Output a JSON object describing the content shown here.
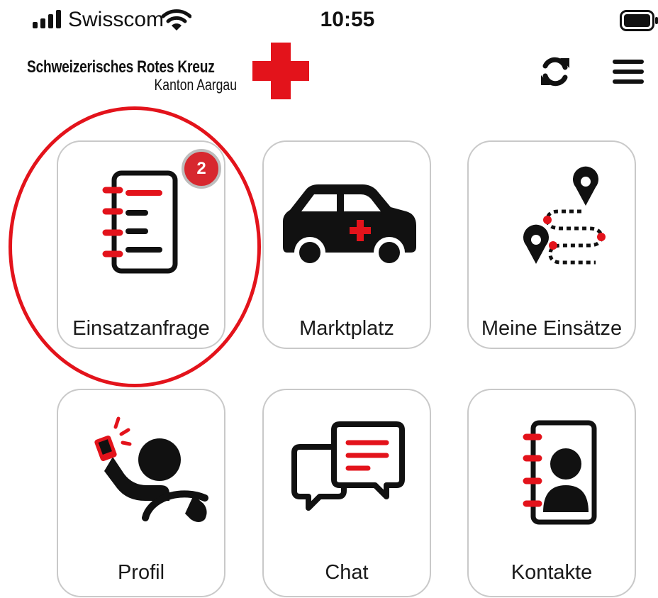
{
  "status_bar": {
    "carrier": "Swisscom",
    "time": "10:55",
    "signal_icon": "cellular-signal-icon",
    "wifi_icon": "wifi-icon",
    "battery_icon": "battery-icon"
  },
  "header": {
    "org_name": "Schweizerisches Rotes Kreuz",
    "org_sub": "Kanton Aargau",
    "logo_icon": "red-cross-icon",
    "sync_icon": "sync-icon",
    "menu_icon": "hamburger-menu-icon"
  },
  "tiles": [
    {
      "label": "Einsatzanfrage",
      "icon": "notepad-list-icon",
      "badge": "2",
      "highlighted": true
    },
    {
      "label": "Marktplatz",
      "icon": "medical-car-icon"
    },
    {
      "label": "Meine Einsätze",
      "icon": "route-map-pins-icon"
    },
    {
      "label": "Profil",
      "icon": "driver-with-phone-icon"
    },
    {
      "label": "Chat",
      "icon": "chat-bubbles-icon"
    },
    {
      "label": "Kontakte",
      "icon": "contact-book-icon"
    }
  ],
  "colors": {
    "accent_red": "#e3131b",
    "icon_black": "#111111",
    "tile_border": "#c9c9c9",
    "highlight_ring": "#e3131b"
  }
}
